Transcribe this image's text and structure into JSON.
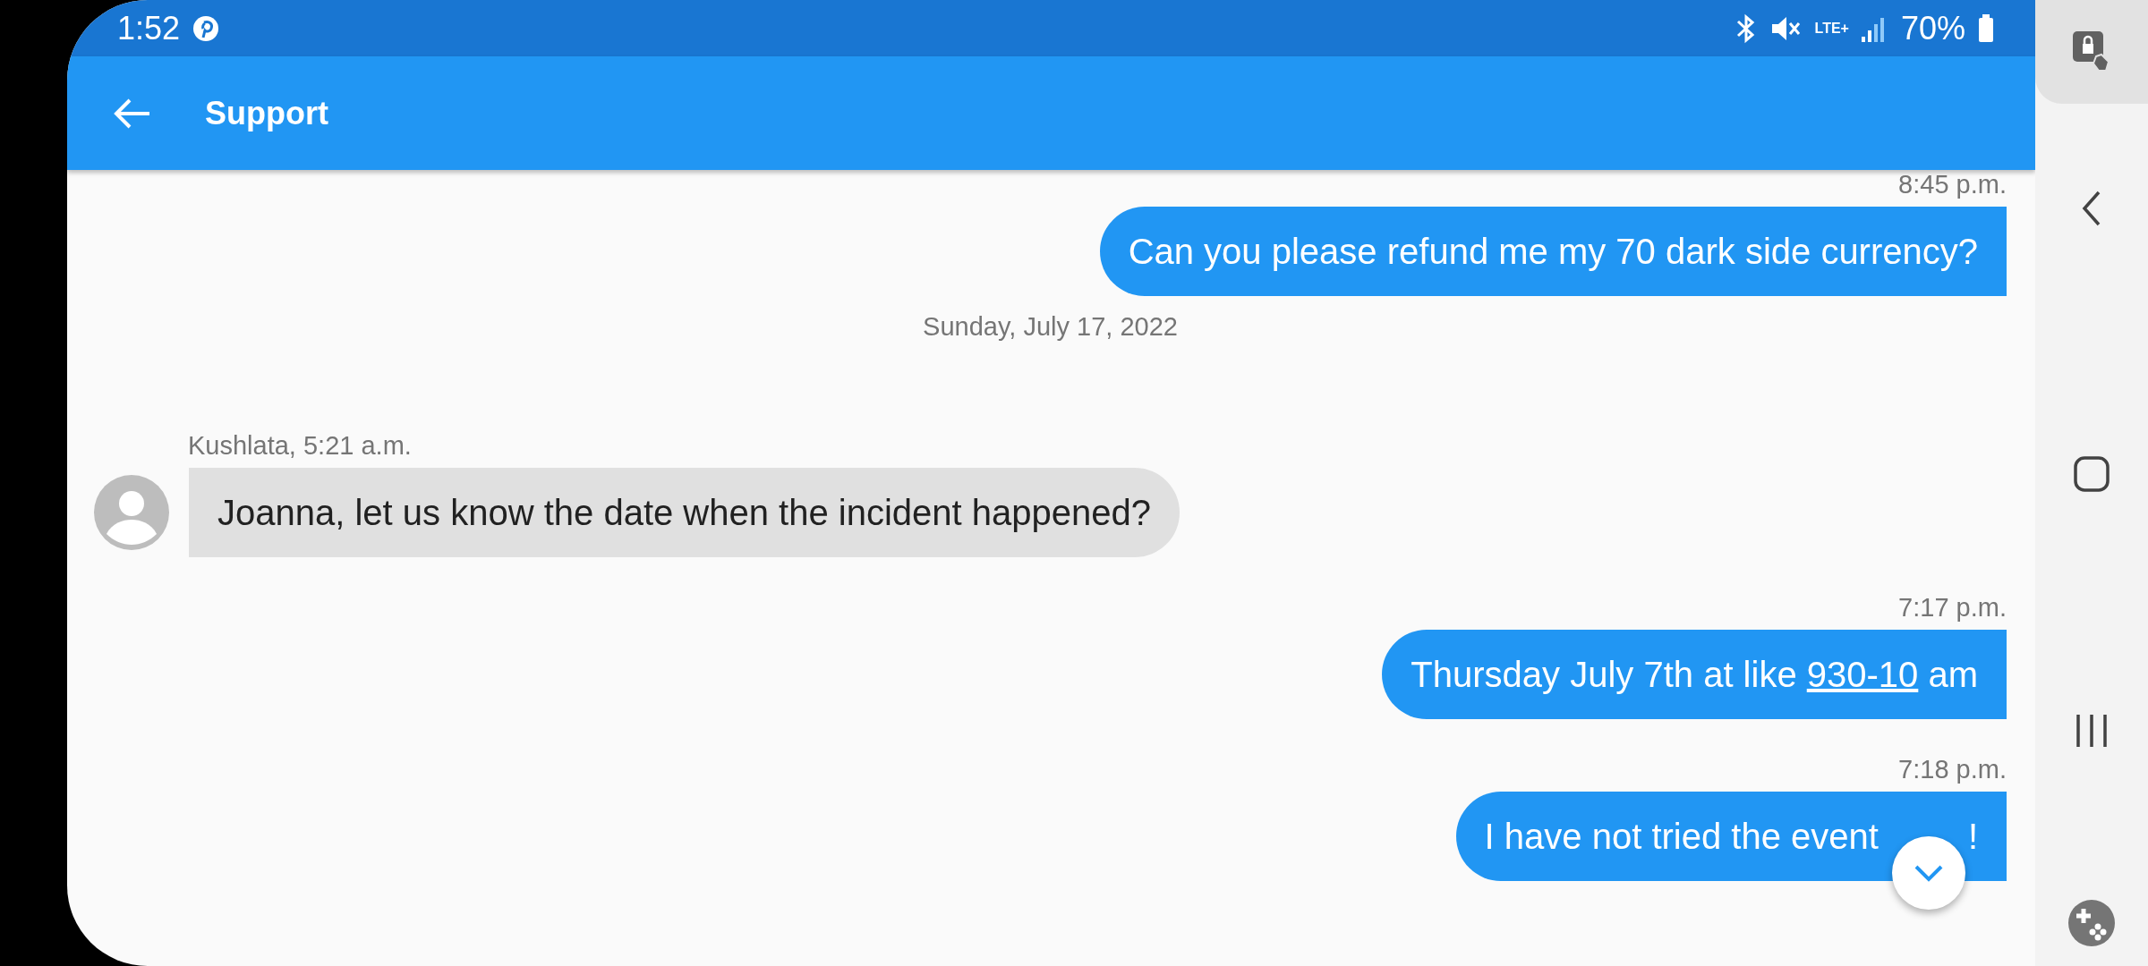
{
  "status_bar": {
    "time": "1:52",
    "network": "LTE+",
    "battery": "70%"
  },
  "app_bar": {
    "title": "Support"
  },
  "messages": [
    {
      "kind": "time",
      "text": "8:45 p.m."
    },
    {
      "kind": "outgoing",
      "parts": [
        {
          "text": "Can you please refund me my 70 dark side currency?"
        }
      ]
    },
    {
      "kind": "date",
      "text": "Sunday, July 17, 2022"
    },
    {
      "kind": "sender",
      "text": "Kushlata, 5:21 a.m."
    },
    {
      "kind": "incoming",
      "parts": [
        {
          "text": "Joanna, let us know the date when the incident happened?"
        }
      ]
    },
    {
      "kind": "time",
      "text": "7:17 p.m."
    },
    {
      "kind": "outgoing",
      "parts": [
        {
          "text": "Thursday July 7th at like "
        },
        {
          "text": "930-10",
          "kind": "link"
        },
        {
          "text": " am"
        }
      ]
    },
    {
      "kind": "time",
      "text": "7:18 p.m."
    },
    {
      "kind": "outgoing",
      "parts": [
        {
          "text": "I have not tried the event"
        },
        {
          "text": "!",
          "kind": "after_fab"
        }
      ]
    }
  ]
}
